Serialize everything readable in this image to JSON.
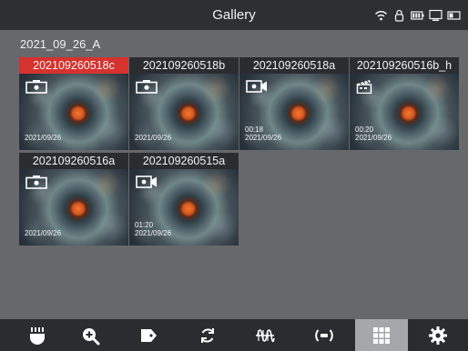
{
  "header": {
    "title": "Gallery",
    "status_icons": [
      "wifi-icon",
      "lock-icon",
      "battery-icon",
      "display-icon",
      "card-icon"
    ]
  },
  "folder": {
    "name": "2021_09_26_A"
  },
  "items": [
    {
      "label": "202109260518c",
      "type": "photo",
      "icon": "camera-icon",
      "duration": "",
      "date": "2021/09/26",
      "selected": true
    },
    {
      "label": "202109260518b",
      "type": "photo",
      "icon": "camera-icon",
      "duration": "",
      "date": "2021/09/26",
      "selected": false
    },
    {
      "label": "202109260518a",
      "type": "video",
      "icon": "video-camera-icon",
      "duration": "00:18",
      "date": "2021/09/26",
      "selected": false
    },
    {
      "label": "202109260516b_h",
      "type": "clip",
      "icon": "clapperboard-icon",
      "duration": "00:20",
      "date": "2021/09/26",
      "selected": false
    },
    {
      "label": "202109260516a",
      "type": "photo",
      "icon": "camera-icon",
      "duration": "",
      "date": "2021/09/26",
      "selected": false
    },
    {
      "label": "202109260515a",
      "type": "video",
      "icon": "video-camera-icon",
      "duration": "01:20",
      "date": "2021/09/26",
      "selected": false
    }
  ],
  "toolbar": {
    "buttons": [
      {
        "icon": "light-icon",
        "active": false
      },
      {
        "icon": "zoom-in-icon",
        "active": false
      },
      {
        "icon": "tag-icon",
        "active": false
      },
      {
        "icon": "rotate-icon",
        "active": false
      },
      {
        "icon": "wave-filter-icon",
        "active": false
      },
      {
        "icon": "sensor-icon",
        "active": false
      },
      {
        "icon": "grid-icon",
        "active": true
      },
      {
        "icon": "gear-icon",
        "active": false
      }
    ]
  },
  "colors": {
    "background": "#67686c",
    "bar": "#2b2c30",
    "selected": "#d6322e",
    "active_tool": "#a6a7ab"
  }
}
